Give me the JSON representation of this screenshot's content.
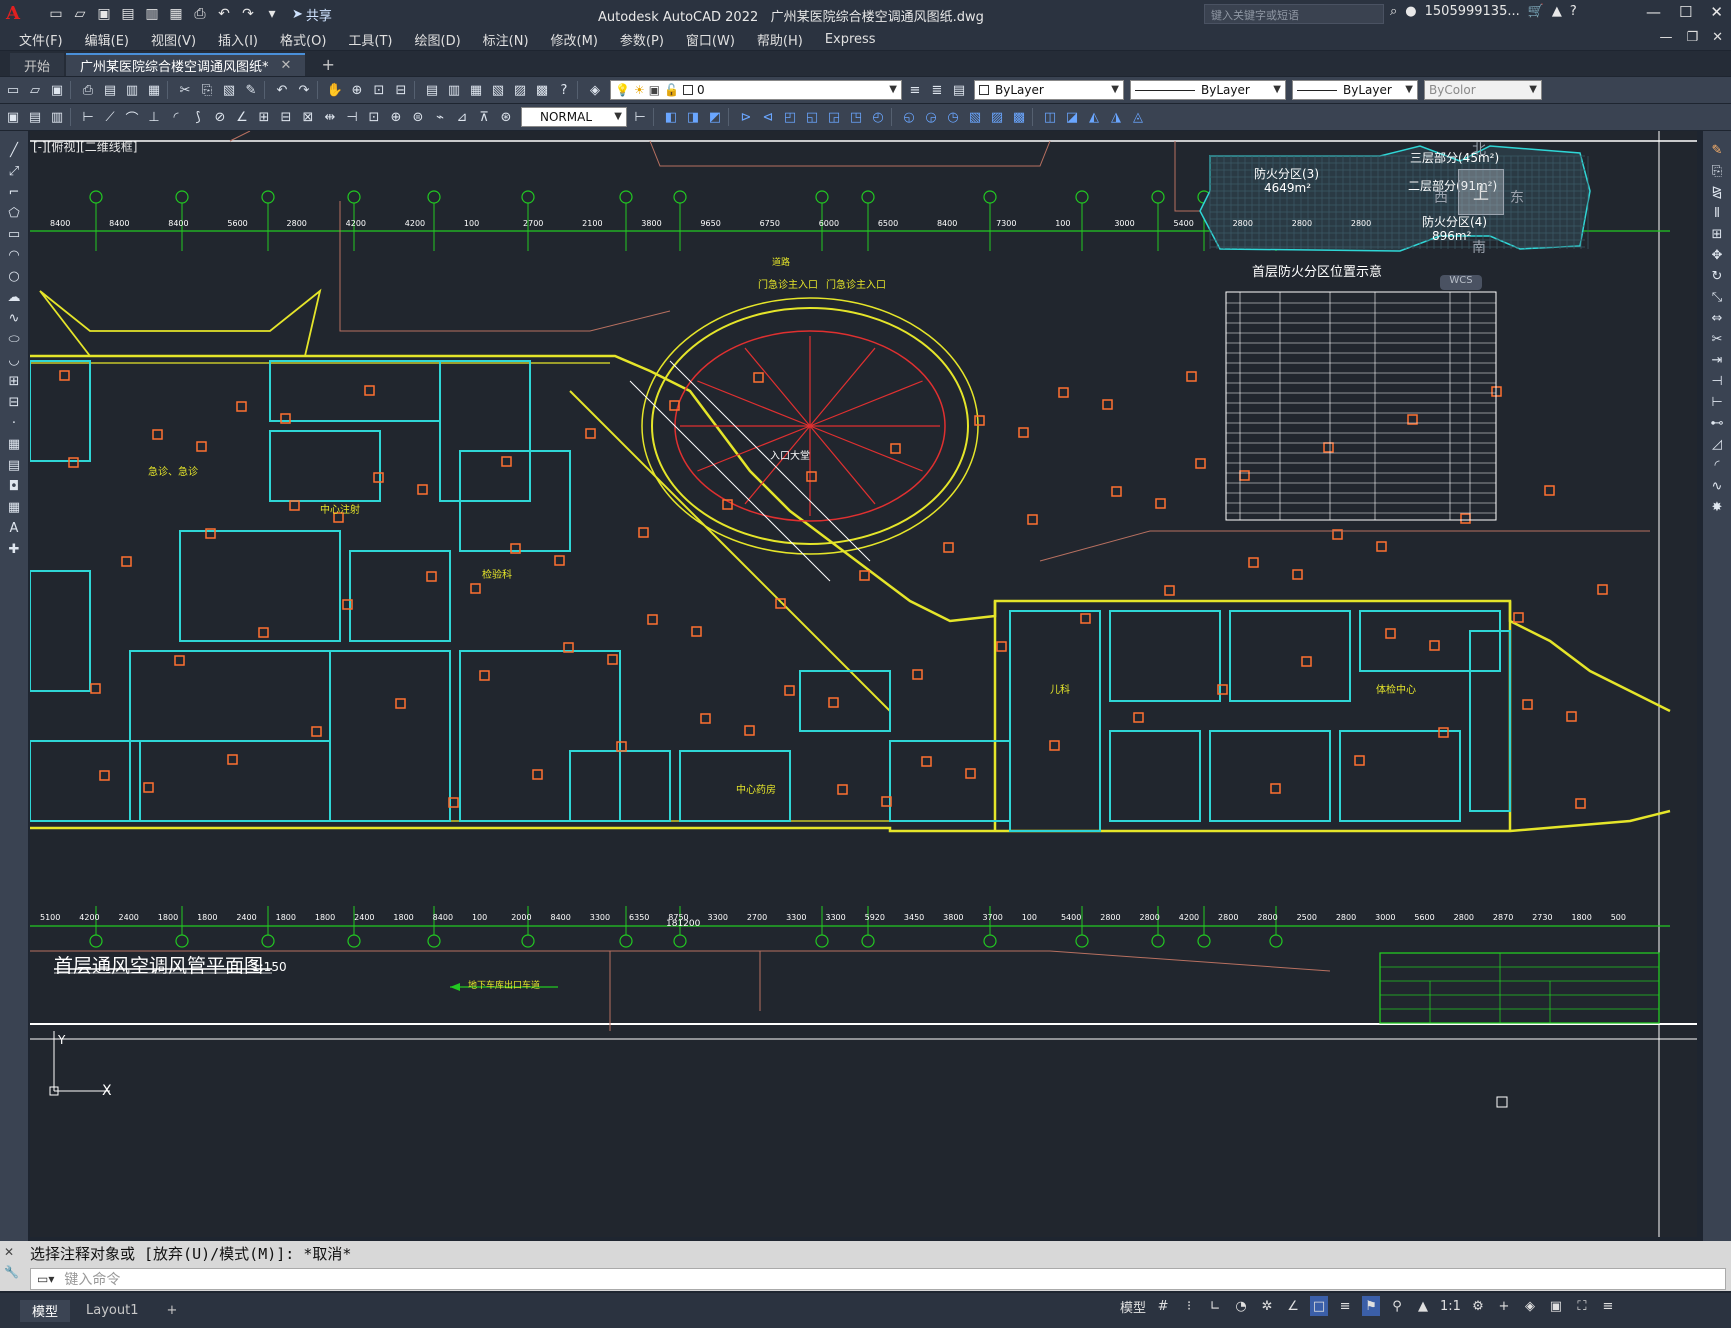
{
  "title_bar": {
    "app_title": "Autodesk AutoCAD 2022",
    "file_title": "广州某医院综合楼空调通风图纸.dwg",
    "share_label": "共享",
    "search_placeholder": "键入关键字或短语",
    "user_name": "1505999135...",
    "help_label": "?"
  },
  "menu": {
    "items": [
      "文件(F)",
      "编辑(E)",
      "视图(V)",
      "插入(I)",
      "格式(O)",
      "工具(T)",
      "绘图(D)",
      "标注(N)",
      "修改(M)",
      "参数(P)",
      "窗口(W)",
      "帮助(H)",
      "Express"
    ]
  },
  "tabs": {
    "start": "开始",
    "document": "广州某医院综合楼空调通风图纸*"
  },
  "layer_toolbar": {
    "layer_value": "0",
    "color_value": "ByLayer",
    "linetype_value": "ByLayer",
    "lineweight_value": "ByLayer",
    "plotstyle_value": "ByColor"
  },
  "style_toolbar": {
    "dimstyle_value": "NORMAL"
  },
  "viewport": {
    "label": "[-][俯视][二维线框]",
    "wcs_label": "WCS",
    "viewcube": {
      "north": "北",
      "south": "南",
      "east": "东",
      "west": "西",
      "top": "上"
    }
  },
  "drawing": {
    "plan_title": "首层通风空调风管平面图",
    "plan_scale": "1:150",
    "fire_zone_title": "首层防火分区位置示意",
    "fire_zone_3": "防火分区(3)",
    "fire_zone_3_area": "4649m²",
    "fire_zone_4": "防火分区(4)",
    "fire_zone_4_area": "896m²",
    "third_floor": "三层部分(45m²)",
    "second_floor": "二层部分(91m²)",
    "lobby": "入口大堂",
    "central_injection": "中心注射",
    "emergency": "急诊、急诊",
    "inspection": "检验科",
    "central_pharmacy": "中心药房",
    "physical_center": "体检中心",
    "pediatrics": "儿科",
    "underground_exit": "地下车库出口车道",
    "outpatient_entrance_1": "门急诊主入口",
    "outpatient_entrance_2": "门急诊主入口",
    "road": "道路",
    "dimension_top": [
      "8400",
      "8400",
      "8400",
      "5600",
      "2800",
      "4200",
      "4200",
      "100",
      "2700",
      "2100",
      "3800",
      "9650",
      "6750",
      "6000",
      "6500",
      "8400",
      "7300",
      "100",
      "3000",
      "5400",
      "2800",
      "2800",
      "2800"
    ],
    "dimension_bottom": [
      "5100",
      "4200",
      "2400",
      "1800",
      "1800",
      "2400",
      "1800",
      "1800",
      "2400",
      "1800",
      "8400",
      "100",
      "2000",
      "8400",
      "3300",
      "6350",
      "8750",
      "3300",
      "2700",
      "3300",
      "3300",
      "5920",
      "3450",
      "3800",
      "3700",
      "100",
      "5400",
      "2800",
      "2800",
      "4200",
      "2800",
      "2800",
      "2500",
      "2800",
      "3000",
      "5600",
      "2800",
      "2870",
      "2730",
      "1800",
      "500"
    ],
    "overall_width": "181200"
  },
  "command": {
    "history": "选择注释对象或 [放弃(U)/模式(M)]: *取消*",
    "placeholder": "键入命令"
  },
  "status": {
    "model_tab": "模型",
    "layout_tab": "Layout1",
    "model_button": "模型",
    "scale": "1:1"
  }
}
